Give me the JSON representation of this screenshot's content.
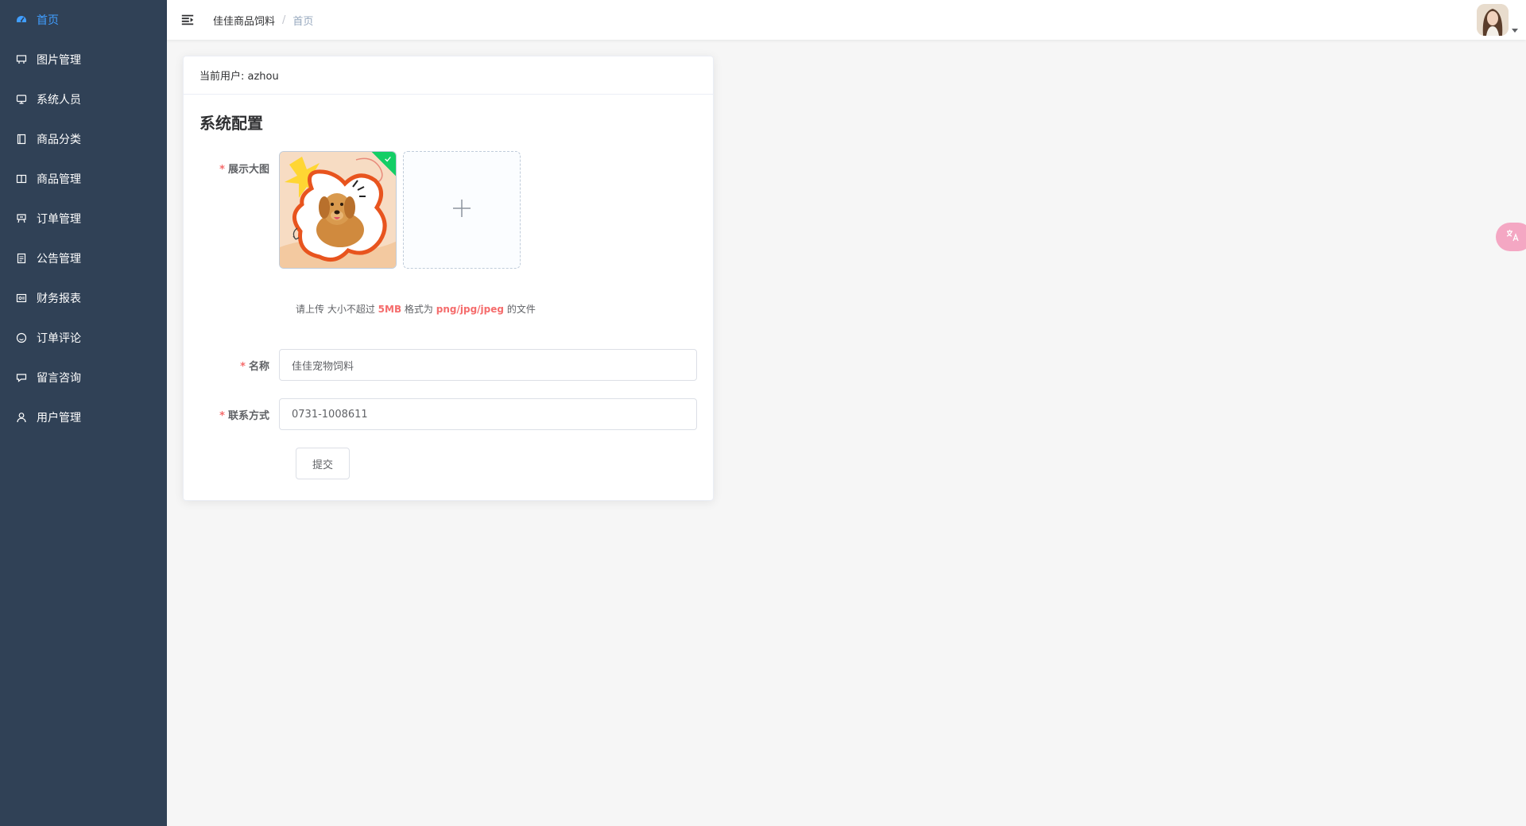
{
  "sidebar": {
    "bg_color": "#304156",
    "active_color": "#409eff",
    "items": [
      {
        "label": "首页",
        "icon": "dashboard-icon",
        "active": true
      },
      {
        "label": "图片管理",
        "icon": "picture-icon"
      },
      {
        "label": "系统人员",
        "icon": "monitor-icon"
      },
      {
        "label": "商品分类",
        "icon": "category-icon"
      },
      {
        "label": "商品管理",
        "icon": "book-icon"
      },
      {
        "label": "订单管理",
        "icon": "order-icon"
      },
      {
        "label": "公告管理",
        "icon": "document-icon"
      },
      {
        "label": "财务报表",
        "icon": "report-icon"
      },
      {
        "label": "订单评论",
        "icon": "comment-icon"
      },
      {
        "label": "留言咨询",
        "icon": "message-icon"
      },
      {
        "label": "用户管理",
        "icon": "user-icon"
      }
    ]
  },
  "header": {
    "breadcrumb": [
      "佳佳商品饲料",
      "首页"
    ],
    "separator": "/"
  },
  "card": {
    "current_user_label": "当前用户: azhou",
    "section_title": "系统配置",
    "upload": {
      "label": "展示大图",
      "hint_prefix": "请上传 大小不超过",
      "hint_size": "5MB",
      "hint_mid": "格式为",
      "hint_formats": "png/jpg/jpeg",
      "hint_suffix": "的文件",
      "success_color": "#13ce66"
    },
    "name": {
      "label": "名称",
      "value": "佳佳宠物饲料"
    },
    "contact": {
      "label": "联系方式",
      "value": "0731-1008611"
    },
    "submit_label": "提交",
    "required_mark": "*"
  }
}
